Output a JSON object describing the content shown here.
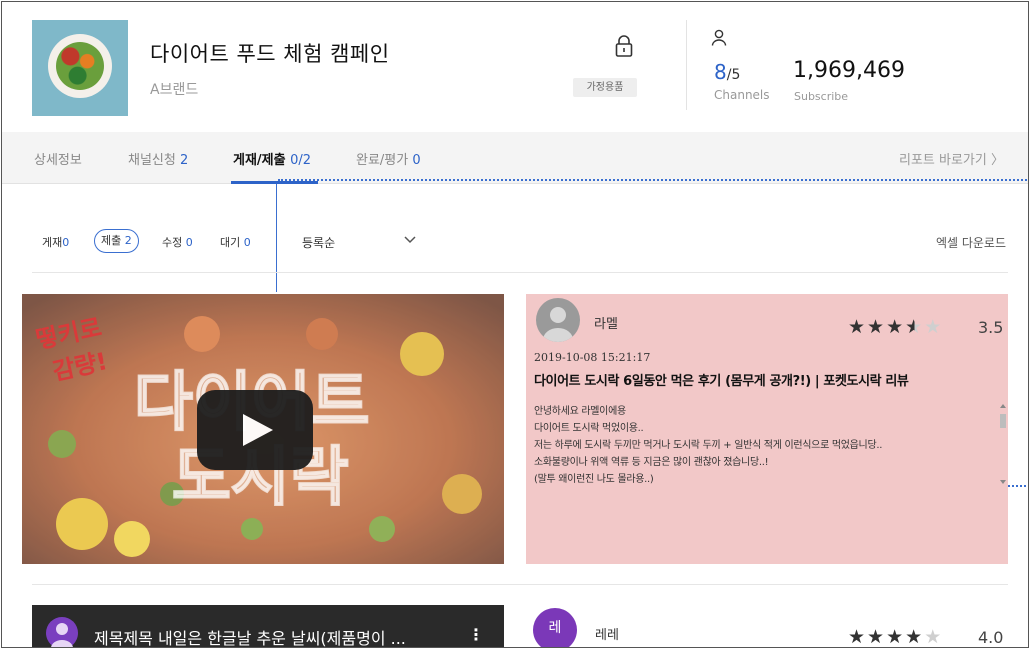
{
  "campaign": {
    "title": "다이어트 푸드 체험 캠페인",
    "brand": "A브랜드",
    "category": "가정용품"
  },
  "stats": {
    "channels_value": "8",
    "channels_max": "/5",
    "channels_label": "Channels",
    "subscribe_value": "1,969,469",
    "subscribe_label": "Subscribe"
  },
  "tabs": [
    {
      "label": "상세정보",
      "count": ""
    },
    {
      "label": "채널신청",
      "count": "2"
    },
    {
      "label": "게재/제출",
      "count": "0/2",
      "active": true
    },
    {
      "label": "완료/평가",
      "count": "0"
    }
  ],
  "report_link": "리포트 바로가기 〉",
  "filters": [
    {
      "label": "게재",
      "count": "0"
    },
    {
      "label": "제출",
      "count": "2",
      "active": true
    },
    {
      "label": "수정",
      "count": "0"
    },
    {
      "label": "대기",
      "count": "0"
    }
  ],
  "sort": {
    "selected": "등록순"
  },
  "excel_download": "엑셀 다운로드",
  "reviews": [
    {
      "name": "라멜",
      "rating": 3.5,
      "rating_text": "3.5",
      "date": "2019-10-08 15:21:17",
      "title": "다이어트 도시락 6일동안 먹은 후기 (몸무게 공개?!) | 포켓도시락 리뷰",
      "body": [
        "안녕하세요 라멜이에용",
        "다이어트 도시락 먹었이용..",
        "저는 하루에 도시락 두끼만 먹거나 도시락 두끼 + 일반식 적게 이런식으로 먹었읍니당..",
        "소화불량이나 위액 역류 등 지금은 많이 괜찮아 졌습니당..!",
        "(말투 왜이런진 나도 몰라용..)"
      ],
      "video_text": [
        "떻키로",
        "감량!",
        "다이어트",
        "도시락"
      ]
    },
    {
      "name": "레레",
      "avatar_text": "레",
      "rating": 4.0,
      "rating_text": "4.0",
      "video_title": "제목제목 내일은 한글날 추운 날씨(제품명이 ...",
      "video_menu": "⋮"
    }
  ],
  "colors": {
    "accent": "#2d63c8",
    "review_bg": "#f2c8c8",
    "tab_bg": "#f4f4f4"
  }
}
